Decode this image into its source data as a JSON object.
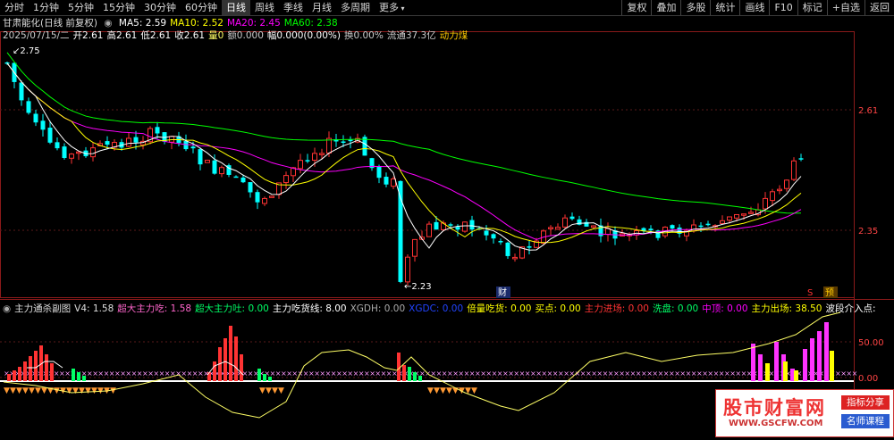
{
  "periods": [
    "分时",
    "1分钟",
    "5分钟",
    "15分钟",
    "30分钟",
    "60分钟",
    "日线",
    "周线",
    "季线",
    "月线",
    "多周期",
    "更多"
  ],
  "active_period": "日线",
  "right_buttons": [
    "复权",
    "叠加",
    "多股",
    "统计",
    "画线",
    "F10",
    "标记",
    "+自选",
    "返回"
  ],
  "stock": {
    "name_line": "甘肃能化(日线 前复权)",
    "ma": [
      {
        "label": "MA5: 2.59",
        "color": "#ffffff"
      },
      {
        "label": "MA10: 2.52",
        "color": "#ffff00"
      },
      {
        "label": "MA20: 2.45",
        "color": "#ff00ff"
      },
      {
        "label": "MA60: 2.38",
        "color": "#00ff00"
      }
    ],
    "info_items": [
      {
        "text": "2025/07/15/二",
        "color": "#cccccc"
      },
      {
        "text": "开2.61",
        "color": "#ffffff"
      },
      {
        "text": "高2.61",
        "color": "#ffffff"
      },
      {
        "text": "低2.61",
        "color": "#ffffff"
      },
      {
        "text": "收2.61",
        "color": "#ffffff"
      },
      {
        "text": "量0",
        "color": "#ffff66"
      },
      {
        "text": "额0.000",
        "color": "#cccccc"
      },
      {
        "text": "幅0.000(0.00%)",
        "color": "#ffffff"
      },
      {
        "text": "换0.00%",
        "color": "#cccccc"
      },
      {
        "text": "流通37.3亿",
        "color": "#cccccc"
      },
      {
        "text": "动力煤",
        "color": "#ffcc00"
      }
    ]
  },
  "price_axis": [
    "2.61",
    "2.35"
  ],
  "annotations": {
    "high": "2.75",
    "low": "2.23",
    "cai": "财",
    "s": "S",
    "yu": "预"
  },
  "indicator": {
    "items": [
      {
        "text": "主力通杀副图",
        "color": "#dddddd"
      },
      {
        "text": "V4: 1.58",
        "color": "#dddddd"
      },
      {
        "text": "超大主力吃: 1.58",
        "color": "#ff66cc"
      },
      {
        "text": "超大主力吐: 0.00",
        "color": "#00ff66"
      },
      {
        "text": "主力吃货线: 8.00",
        "color": "#ffffff"
      },
      {
        "text": "XGDH: 0.00",
        "color": "#aaaaaa"
      },
      {
        "text": "XGDC: 0.00",
        "color": "#2244ff"
      },
      {
        "text": "倍量吃货: 0.00",
        "color": "#ffff00"
      },
      {
        "text": "买点: 0.00",
        "color": "#ffff00"
      },
      {
        "text": "主力进场: 0.00",
        "color": "#ff3333"
      },
      {
        "text": "洗盘: 0.00",
        "color": "#00ff66"
      },
      {
        "text": "中顶: 0.00",
        "color": "#ff00ff"
      },
      {
        "text": "主力出场: 38.50",
        "color": "#ffff00"
      },
      {
        "text": "波段介入点:",
        "color": "#ffffff"
      }
    ],
    "axis": [
      "50.00",
      "0.00"
    ]
  },
  "logo": {
    "text": "股市财富网",
    "url": "WWW.GSCFW.COM",
    "tag1": "指标分享",
    "tag2": "名师课程"
  },
  "colors": {
    "up": "#ff3333",
    "down": "#00ffff",
    "ma5": "#ffffff",
    "ma10": "#ffff00",
    "ma20": "#ff00ff",
    "ma60": "#00ff00"
  }
}
